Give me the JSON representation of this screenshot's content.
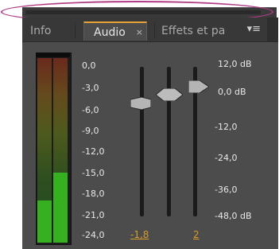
{
  "tabs": {
    "info": "Info",
    "audio": "Audio",
    "audio_close": "×",
    "effets": "Effets et pa",
    "menu_icon": "menu-icon"
  },
  "meter": {
    "scale": [
      "0,0",
      "-3,0",
      "-6,0",
      "-9,0",
      "-12,0",
      "-15,0",
      "-18,0",
      "-21,0",
      "-24,0"
    ],
    "left_level_fraction": 0.23,
    "right_level_fraction": 0.38
  },
  "faders": {
    "scale": [
      "12,0 dB",
      "0,0 dB",
      "-12,0",
      "-24,0",
      "-36,0",
      "-48,0 dB"
    ],
    "left_value": "-1,8",
    "right_value": "2"
  },
  "colors": {
    "accent": "#d59a2a",
    "meter_green": "#36b020",
    "annotation": "#b03c86"
  }
}
